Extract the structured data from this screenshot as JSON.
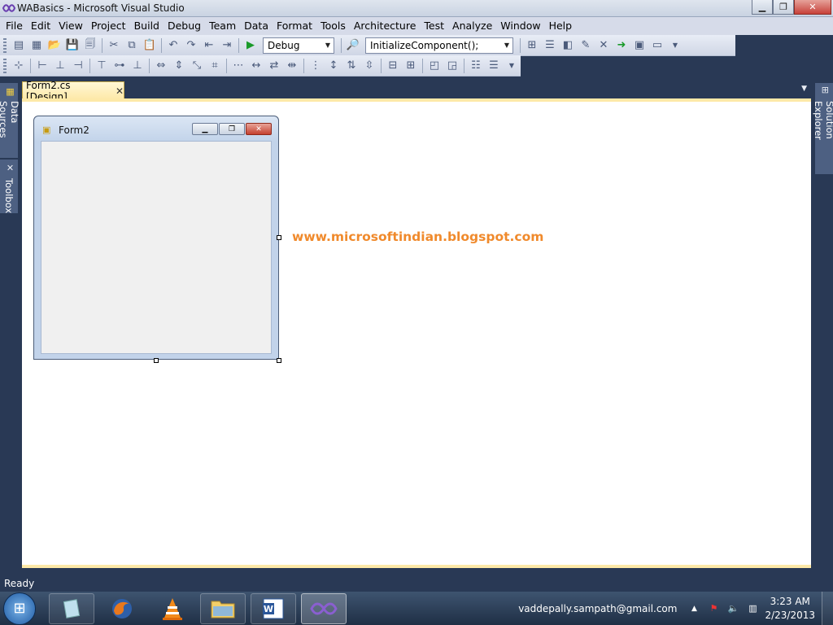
{
  "window": {
    "title": "WABasics - Microsoft Visual Studio",
    "minimize_glyph": "▁",
    "restore_glyph": "❐",
    "close_glyph": "✕"
  },
  "menu": [
    "File",
    "Edit",
    "View",
    "Project",
    "Build",
    "Debug",
    "Team",
    "Data",
    "Format",
    "Tools",
    "Architecture",
    "Test",
    "Analyze",
    "Window",
    "Help"
  ],
  "toolbar": {
    "config_value": "Debug",
    "find_value": "InitializeComponent();"
  },
  "side_tabs": {
    "left": [
      "Data Sources",
      "Toolbox"
    ],
    "right": [
      "Solution Explorer"
    ]
  },
  "document_tab": {
    "label": "Form2.cs [Design]",
    "close_glyph": "✕"
  },
  "form_designer": {
    "form_title": "Form2"
  },
  "watermark": "www.microsoftindian.blogspot.com",
  "status": {
    "text": "Ready"
  },
  "taskbar": {
    "email": "vaddepally.sampath@gmail.com",
    "time": "3:23 AM",
    "date": "2/23/2013"
  },
  "colors": {
    "accent_orange": "#f08a2c",
    "vs_dark_blue": "#293955",
    "doc_tab_yellow": "#fde9a8"
  }
}
